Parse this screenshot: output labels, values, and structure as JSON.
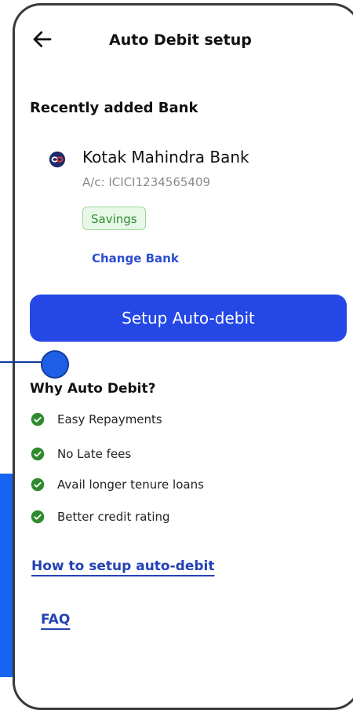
{
  "header": {
    "title": "Auto Debit setup",
    "back_icon": "arrow-left-icon"
  },
  "bank_section": {
    "title": "Recently added Bank",
    "bank_name": "Kotak Mahindra Bank",
    "account": "A/c: ICICI1234565409",
    "account_type": "Savings",
    "change_bank": "Change Bank",
    "logo_icon": "kotak-logo-icon"
  },
  "primary_action": {
    "label": "Setup Auto-debit"
  },
  "why": {
    "title": "Why Auto Debit?",
    "items": [
      {
        "label": "Easy Repayments"
      },
      {
        "label": "No Late fees"
      },
      {
        "label": "Avail longer tenure loans"
      },
      {
        "label": "Better credit rating"
      }
    ]
  },
  "links": {
    "how_to": "How to setup auto-debit",
    "faq": "FAQ"
  },
  "colors": {
    "primary": "#2447e6",
    "check": "#2e8b2e",
    "background_blue": "#1565f0"
  }
}
